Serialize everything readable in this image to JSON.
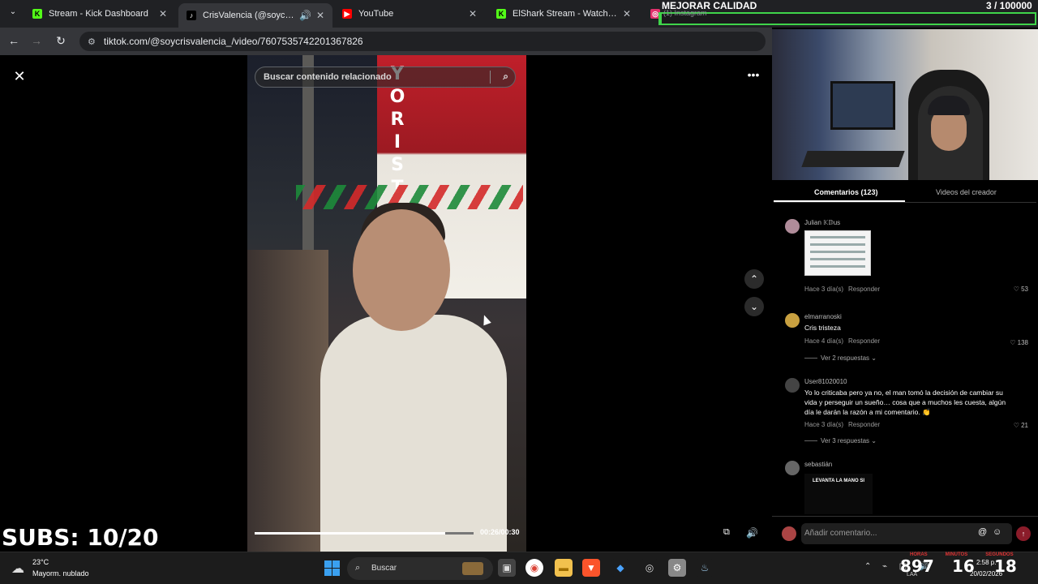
{
  "browser": {
    "tabs": [
      {
        "label": "Stream - Kick Dashboard",
        "icon": "kick-icon",
        "color": "#53fc18"
      },
      {
        "label": "CrisValencia (@soycrisvalen",
        "icon": "tiktok-icon",
        "color": "#ffffff",
        "active": true,
        "audio": true
      },
      {
        "label": "YouTube",
        "icon": "youtube-icon",
        "color": "#ff0000"
      },
      {
        "label": "ElShark Stream - Watch Live on",
        "icon": "kick-icon",
        "color": "#53fc18"
      },
      {
        "label": "(1) Instagram",
        "icon": "instagram-icon",
        "color": "#e1306c"
      }
    ],
    "url": "tiktok.com/@soycrisvalencia_/video/7607535742201367826"
  },
  "video": {
    "search_placeholder": "Buscar contenido relacionado",
    "time": "00:26/00:30",
    "progress": 0.87
  },
  "overlay": {
    "quality": "MEJORAR CALIDAD",
    "goal": "3  / 100000",
    "goal_progress": 3e-05,
    "subs": "SUBS: 10/20"
  },
  "comments": {
    "tab_comments": "Comentarios (123)",
    "tab_videos": "Videos del creador",
    "items": [
      {
        "name": "Julian 𝕂𝔻us",
        "text": "",
        "time": "Hace 3 día(s)",
        "reply": "Responder",
        "likes": "♡ 53",
        "avatar_color": "#b08c9a"
      },
      {
        "name": "elmarranoski",
        "text": "Cris tristeza",
        "time": "Hace 4 día(s)",
        "reply": "Responder",
        "likes": "♡ 138",
        "more": "Ver 2 respuestas ⌄",
        "avatar_color": "#c8a040"
      },
      {
        "name": "User81020010",
        "text": "Yo lo criticaba pero ya no, el man tomó la decisión de cambiar su vida y perseguir un sueño… cosa que a muchos les cuesta, algún día le darán la razón a mi comentario. 👏",
        "time": "Hace 3 día(s)",
        "reply": "Responder",
        "likes": "♡ 21",
        "more": "Ver 3 respuestas ⌄",
        "avatar_color": "#444444"
      },
      {
        "name": "sebastián",
        "text": "",
        "image_text": "LEVANTA LA MANO SI",
        "avatar_color": "#666666"
      }
    ],
    "input_placeholder": "Añadir comentario..."
  },
  "taskbar": {
    "temp": "23°C",
    "weather": "Mayorm. nublado",
    "search": "Buscar",
    "counter": "897",
    "timer_labels": [
      "HORAS",
      "MINUTOS",
      "SEGUNDOS"
    ],
    "hours": "16",
    "seconds": "18",
    "time": "2:58 p.",
    "date": "20/02/2026",
    "lang": "LAA"
  }
}
